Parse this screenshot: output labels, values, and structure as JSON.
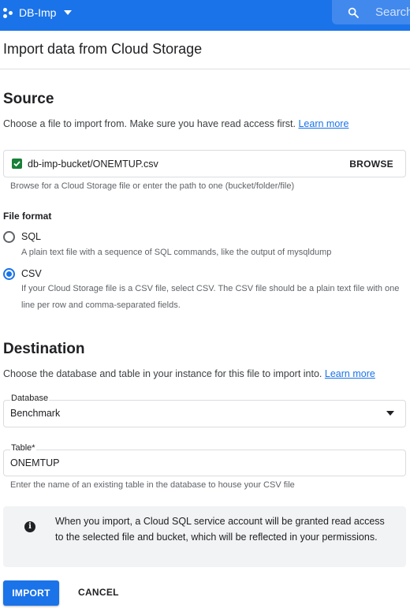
{
  "header": {
    "project_name": "DB-Imp",
    "search_placeholder": "Search",
    "accent_color": "#1a73e8"
  },
  "page": {
    "title": "Import data from Cloud Storage"
  },
  "source": {
    "heading": "Source",
    "description": "Choose a file to import from. Make sure you have read access first.",
    "learn_more": "Learn more",
    "file_path": "db-imp-bucket/ONEMTUP.csv",
    "browse_label": "BROWSE",
    "file_hint": "Browse for a Cloud Storage file or enter the path to one (bucket/folder/file)"
  },
  "file_format": {
    "label": "File format",
    "options": [
      {
        "label": "SQL",
        "description": "A plain text file with a sequence of SQL commands, like the output of mysqldump",
        "selected": false
      },
      {
        "label": "CSV",
        "description": "If your Cloud Storage file is a CSV file, select CSV. The CSV file should be a plain text file with one line per row and comma-separated fields.",
        "selected": true
      }
    ]
  },
  "destination": {
    "heading": "Destination",
    "description": "Choose the database and table in your instance for this file to import into.",
    "learn_more": "Learn more",
    "database_label": "Database",
    "database_value": "Benchmark",
    "table_label": "Table*",
    "table_value": "ONEMTUP",
    "table_hint": "Enter the name of an existing table in the database to house your CSV file"
  },
  "info": {
    "icon": "info-icon",
    "text": "When you import, a Cloud SQL service account will be granted read access to the selected file and bucket, which will be reflected in your permissions."
  },
  "actions": {
    "import_label": "IMPORT",
    "cancel_label": "CANCEL"
  }
}
